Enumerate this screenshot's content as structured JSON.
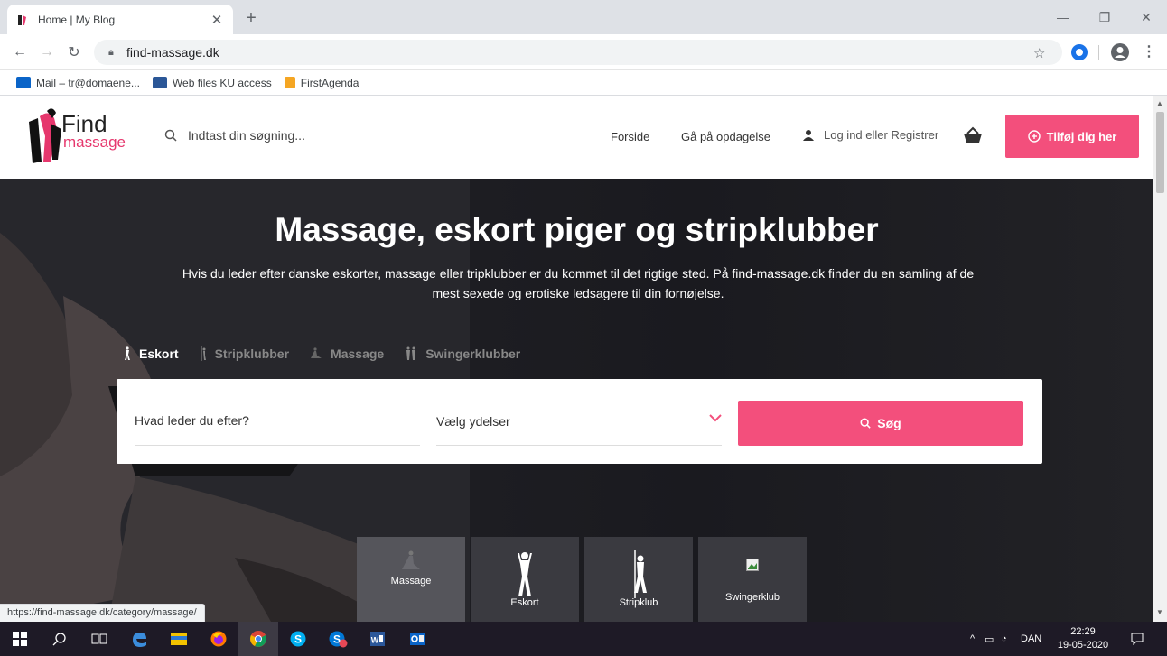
{
  "browser": {
    "tab_title": "Home | My Blog",
    "url": "find-massage.dk",
    "status_url": "https://find-massage.dk/category/massage/",
    "bookmarks": [
      {
        "label": "Mail – tr@domaene...",
        "icon": "outlook-icon",
        "color": "#0a64c8"
      },
      {
        "label": "Web files KU access",
        "icon": "web-files-icon",
        "color": "#2b5797"
      },
      {
        "label": "FirstAgenda",
        "icon": "firstagenda-icon",
        "color": "#f5a623"
      }
    ]
  },
  "site": {
    "logo_top": "Find",
    "logo_bottom": "massage",
    "search_placeholder": "Indtast din søgning...",
    "nav": [
      "Forside",
      "Gå på opdagelse"
    ],
    "login": "Log ind eller Registrer",
    "add_button": "Tilføj dig her",
    "accent": "#f34f7c"
  },
  "hero": {
    "title": "Massage, eskort piger og stripklubber",
    "subtitle_line1": "Hvis du leder efter danske eskorter, massage eller tripklubber er du kommet til det rigtige sted. På find-massage.dk finder du en samling af de",
    "subtitle_line2": "mest sexede og erotiske ledsagere til din fornøjelse.",
    "categories": [
      "Eskort",
      "Stripklubber",
      "Massage",
      "Swingerklubber"
    ],
    "search": {
      "what_placeholder": "Hvad leder du efter?",
      "services_placeholder": "Vælg ydelser",
      "button": "Søg"
    },
    "tiles": [
      "Massage",
      "Eskort",
      "Stripklub",
      "Swingerklub"
    ]
  },
  "taskbar": {
    "lang": "DAN",
    "time": "22:29",
    "date": "19-05-2020"
  }
}
